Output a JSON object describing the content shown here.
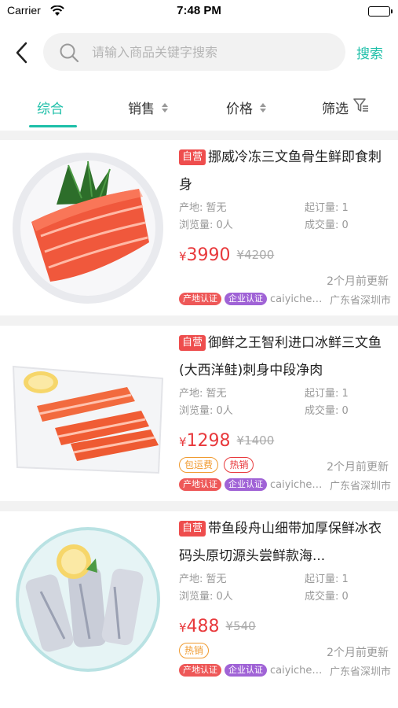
{
  "status_bar": {
    "carrier": "Carrier",
    "time": "7:48 PM"
  },
  "search": {
    "placeholder": "请输入商品关键字搜索",
    "button_label": "搜索"
  },
  "tabs": [
    {
      "label": "综合"
    },
    {
      "label": "销售"
    },
    {
      "label": "价格"
    },
    {
      "label": "筛选"
    }
  ],
  "products": [
    {
      "badge": "自营",
      "title": "挪威冷冻三文鱼骨生鲜即食刺身",
      "origin": "产地: 暂无",
      "min_order": "起订量: 1",
      "views": "浏览量: 0人",
      "deals": "成交量: 0",
      "currency": "¥",
      "price": "3990",
      "old_price": "¥4200",
      "updated": "2个月前更新",
      "tags": [],
      "cert1": "产地认证",
      "cert2": "企业认证",
      "seller": "caiyiche12...",
      "region": "广东省深圳市"
    },
    {
      "badge": "自营",
      "title": "御鲜之王智利进口冰鲜三文鱼(大西洋鲑)刺身中段净肉",
      "origin": "产地: 暂无",
      "min_order": "起订量: 1",
      "views": "浏览量: 0人",
      "deals": "成交量: 0",
      "currency": "¥",
      "price": "1298",
      "old_price": "¥1400",
      "updated": "2个月前更新",
      "tags": [
        "包运费",
        "热销"
      ],
      "cert1": "产地认证",
      "cert2": "企业认证",
      "seller": "caiyiche12...",
      "region": "广东省深圳市"
    },
    {
      "badge": "自营",
      "title": "带鱼段舟山细带加厚保鲜冰衣码头原切源头尝鲜款海...",
      "origin": "产地: 暂无",
      "min_order": "起订量: 1",
      "views": "浏览量: 0人",
      "deals": "成交量: 0",
      "currency": "¥",
      "price": "488",
      "old_price": "¥540",
      "updated": "2个月前更新",
      "tags": [
        "热销"
      ],
      "cert1": "产地认证",
      "cert2": "企业认证",
      "seller": "caiyiche12...",
      "region": "广东省深圳市"
    }
  ],
  "colors": {
    "accent": "#1dbfa8",
    "price": "#e8393c",
    "badge": "#ee4d4d",
    "orange_tag": "#f09a2f",
    "purple_cert": "#a063d6"
  }
}
